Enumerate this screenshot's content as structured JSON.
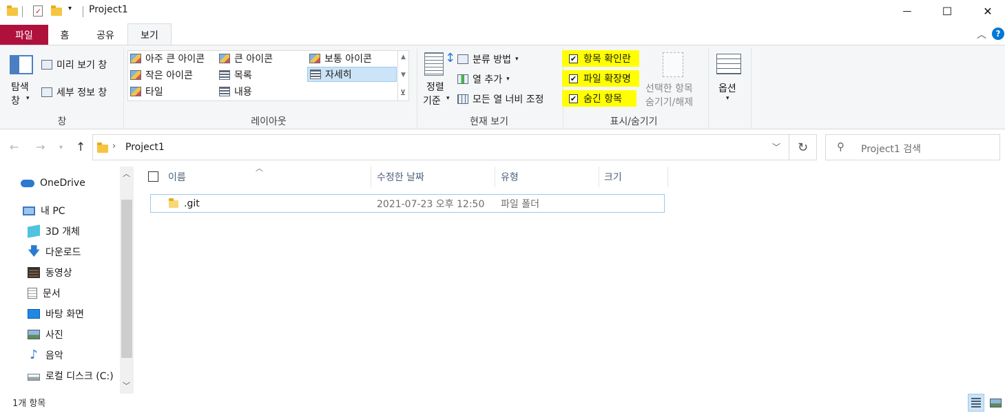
{
  "window": {
    "title": "Project1",
    "controls": {
      "minimize": "—",
      "maximize": "☐",
      "close": "✕"
    }
  },
  "ribbon_tabs": {
    "file": "파일",
    "home": "홈",
    "share": "공유",
    "view": "보기"
  },
  "ribbon": {
    "panes": {
      "nav_pane_line1": "탐색",
      "nav_pane_line2": "창",
      "preview_pane": "미리 보기 창",
      "details_pane": "세부 정보 창",
      "group_label": "창"
    },
    "layout": {
      "items": [
        "아주 큰 아이콘",
        "큰 아이콘",
        "보통 아이콘",
        "작은 아이콘",
        "목록",
        "자세히",
        "타일",
        "내용"
      ],
      "selected": "자세히",
      "group_label": "레이아웃"
    },
    "current_view": {
      "sort_line1": "정렬",
      "sort_line2": "기준",
      "group_by": "분류 방법",
      "add_columns": "열 추가",
      "size_all_columns": "모든 열 너비 조정",
      "group_label": "현재 보기"
    },
    "show_hide": {
      "item_checkboxes": "항목 확인란",
      "file_extensions": "파일 확장명",
      "hidden_items": "숨긴 항목",
      "hide_selected_line1": "선택한 항목",
      "hide_selected_line2": "숨기기/해제",
      "group_label": "표시/숨기기",
      "checked": {
        "item_checkboxes": true,
        "file_extensions": true,
        "hidden_items": true
      },
      "highlight_color": "#ffff00"
    },
    "options": {
      "label": "옵션"
    }
  },
  "address": {
    "path": "Project1",
    "search_placeholder": "Project1 검색"
  },
  "nav_pane": {
    "items": [
      {
        "label": "OneDrive",
        "icon": "onedrive-icon"
      },
      {
        "label": "내 PC",
        "icon": "pc-icon"
      },
      {
        "label": "3D 개체",
        "icon": "3d-objects-icon"
      },
      {
        "label": "다운로드",
        "icon": "download-icon"
      },
      {
        "label": "동영상",
        "icon": "video-icon"
      },
      {
        "label": "문서",
        "icon": "document-icon"
      },
      {
        "label": "바탕 화면",
        "icon": "desktop-icon"
      },
      {
        "label": "사진",
        "icon": "pictures-icon"
      },
      {
        "label": "음악",
        "icon": "music-icon"
      },
      {
        "label": "로컬 디스크 (C:)",
        "icon": "disk-icon"
      }
    ]
  },
  "file_list": {
    "columns": [
      "이름",
      "수정한 날짜",
      "유형",
      "크기"
    ],
    "rows": [
      {
        "name": ".git",
        "modified": "2021-07-23 오후 12:50",
        "type": "파일 폴더",
        "size": ""
      }
    ]
  },
  "status_bar": {
    "item_count": "1개 항목"
  },
  "colors": {
    "file_tab": "#b0103c",
    "selection": "#cce4f7",
    "accent": "#0078d7"
  }
}
